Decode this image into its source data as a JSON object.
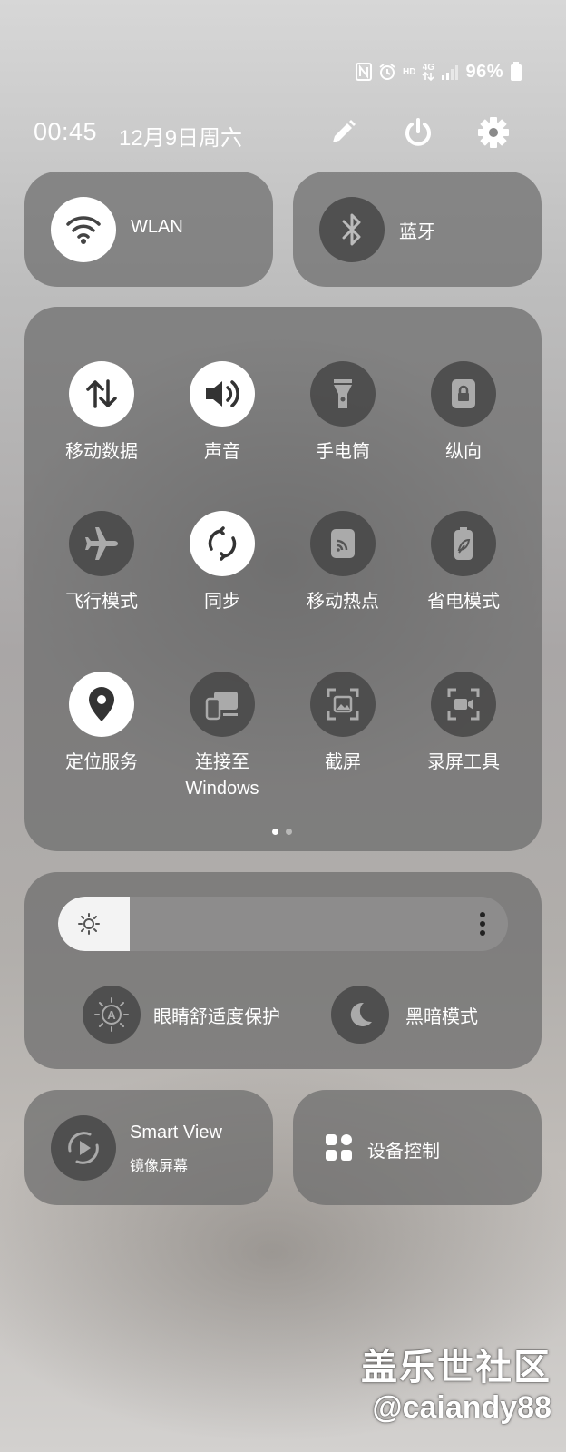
{
  "status_bar": {
    "icons": [
      "nfc-icon",
      "alarm-icon",
      "hd-icon",
      "4g-data-icon",
      "signal-icon"
    ],
    "hd_label": "HD",
    "network_label": "4G",
    "battery_percent": "96%",
    "battery_level": 0.96
  },
  "header": {
    "time": "00:45",
    "date": "12月9日周六",
    "buttons": [
      "edit-icon",
      "power-icon",
      "settings-icon"
    ]
  },
  "top_tiles": [
    {
      "label": "WLAN",
      "icon": "wifi-icon",
      "active": true
    },
    {
      "label": "蓝牙",
      "icon": "bluetooth-icon",
      "active": false
    }
  ],
  "quick_tiles": [
    {
      "label": "移动数据",
      "icon": "mobile-data-icon",
      "active": true
    },
    {
      "label": "声音",
      "icon": "sound-icon",
      "active": true
    },
    {
      "label": "手电筒",
      "icon": "flashlight-icon",
      "active": false
    },
    {
      "label": "纵向",
      "icon": "portrait-lock-icon",
      "active": false
    },
    {
      "label": "飞行模式",
      "icon": "airplane-icon",
      "active": false
    },
    {
      "label": "同步",
      "icon": "sync-icon",
      "active": true
    },
    {
      "label": "移动热点",
      "icon": "hotspot-icon",
      "active": false
    },
    {
      "label": "省电模式",
      "icon": "power-saving-icon",
      "active": false
    },
    {
      "label": "定位服务",
      "icon": "location-icon",
      "active": true
    },
    {
      "label": "连接至\nWindows",
      "icon": "link-to-windows-icon",
      "active": false
    },
    {
      "label": "截屏",
      "icon": "screenshot-icon",
      "active": false
    },
    {
      "label": "录屏工具",
      "icon": "screen-recorder-icon",
      "active": false
    }
  ],
  "page_indicator": {
    "pages": 2,
    "current": 1
  },
  "brightness": {
    "level": 0.16,
    "icon": "brightness-icon",
    "menu_icon": "more-vert-icon",
    "eye_comfort_label": "眼睛舒适度保护",
    "dark_mode_label": "黑暗模式"
  },
  "smart_view": {
    "title": "Smart View",
    "subtitle": "镜像屏幕",
    "icon": "smart-view-icon"
  },
  "device_control": {
    "label": "设备控制",
    "icon": "device-control-icon"
  },
  "watermark": {
    "line1": "盖乐世社区",
    "line2": "@caiandy88"
  }
}
